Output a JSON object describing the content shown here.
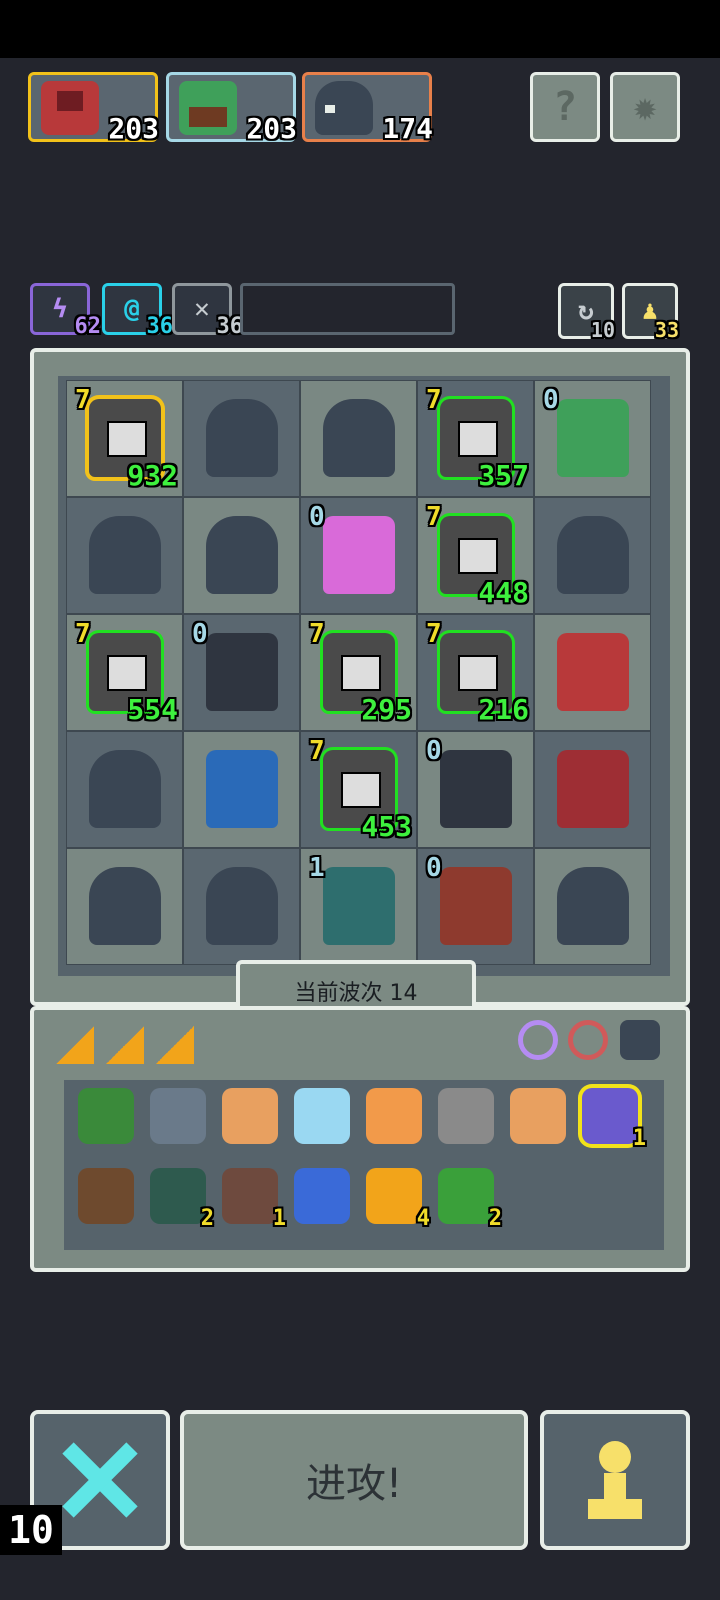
{
  "bosses": [
    {
      "name_icon": "red-demon-icon",
      "count": "203",
      "border": "#f2c21a"
    },
    {
      "name_icon": "frog-icon",
      "count": "203",
      "border": "#a6d8e6"
    },
    {
      "name_icon": "dark-beast-icon",
      "count": "174",
      "border": "#e8804a"
    }
  ],
  "top_buttons": {
    "help_icon": "question-icon",
    "settings_icon": "gear-icon"
  },
  "buffs": [
    {
      "icon": "lightning-icon",
      "value": "62",
      "color": "#b58cf2"
    },
    {
      "icon": "swirl-icon",
      "value": "36",
      "color": "#2ad0e8"
    },
    {
      "icon": "crossed-swords-icon",
      "value": "36",
      "color": "#c6ccd0"
    }
  ],
  "resources": [
    {
      "icon": "refresh-icon",
      "value": "10"
    },
    {
      "icon": "pawn-icon",
      "value": "33"
    }
  ],
  "board": {
    "rows": [
      [
        {
          "unit": "knight",
          "lvl": "7",
          "lvl_color": "y",
          "hp": "932",
          "glow": "gold"
        },
        {
          "unit": "beast"
        },
        {
          "unit": "beast"
        },
        {
          "unit": "knight",
          "lvl": "7",
          "lvl_color": "y",
          "hp": "357",
          "glow": "green"
        },
        {
          "unit": "frog",
          "lvl": "0",
          "lvl_color": "b"
        }
      ],
      [
        {
          "unit": "beast"
        },
        {
          "unit": "beast"
        },
        {
          "unit": "pink-demon",
          "lvl": "0",
          "lvl_color": "b"
        },
        {
          "unit": "knight",
          "lvl": "7",
          "lvl_color": "y",
          "hp": "448",
          "glow": "green"
        },
        {
          "unit": "beast"
        }
      ],
      [
        {
          "unit": "knight",
          "lvl": "7",
          "lvl_color": "y",
          "hp": "554",
          "glow": "green"
        },
        {
          "unit": "ghoul",
          "lvl": "0",
          "lvl_color": "b"
        },
        {
          "unit": "knight",
          "lvl": "7",
          "lvl_color": "y",
          "hp": "295",
          "glow": "green"
        },
        {
          "unit": "knight",
          "lvl": "7",
          "lvl_color": "y",
          "hp": "216",
          "glow": "green"
        },
        {
          "unit": "red-shaman"
        }
      ],
      [
        {
          "unit": "gargoyle"
        },
        {
          "unit": "blue-fish"
        },
        {
          "unit": "knight",
          "lvl": "7",
          "lvl_color": "y",
          "hp": "453",
          "glow": "green"
        },
        {
          "unit": "ghoul",
          "lvl": "0",
          "lvl_color": "b"
        },
        {
          "unit": "red-imp"
        }
      ],
      [
        {
          "unit": "beast"
        },
        {
          "unit": "beast"
        },
        {
          "unit": "teal-blob",
          "lvl": "1",
          "lvl_color": "b"
        },
        {
          "unit": "minotaur",
          "lvl": "0",
          "lvl_color": "b"
        },
        {
          "unit": "beast"
        }
      ]
    ]
  },
  "wave_label": "当前波次 14",
  "inventory": {
    "tabs": [
      "gold-triangle-icon",
      "gold-triangle-icon",
      "gold-triangle-icon"
    ],
    "slots": [
      "purple-ring-icon",
      "red-ring-icon",
      "armor-icon"
    ],
    "items_row1": [
      {
        "icon": "green-cross-shield-icon"
      },
      {
        "icon": "spiked-gear-icon"
      },
      {
        "icon": "claws-icon"
      },
      {
        "icon": "mask-icon"
      },
      {
        "icon": "orange-fruit-icon"
      },
      {
        "icon": "dagger-icon"
      },
      {
        "icon": "hammer-icon"
      },
      {
        "icon": "potion-jar-icon",
        "count": "1"
      }
    ],
    "items_row2": [
      {
        "icon": "spike-trap-icon"
      },
      {
        "icon": "shadow-cube-icon",
        "count": "2"
      },
      {
        "icon": "helmet-icon",
        "count": "1"
      },
      {
        "icon": "blue-flame-icon"
      },
      {
        "icon": "orbit-ring-icon",
        "count": "4"
      },
      {
        "icon": "green-hand-icon",
        "count": "2"
      }
    ]
  },
  "attack_label": "进攻!",
  "corner_number": "10",
  "colors": {
    "background": "#23252d",
    "panel": "#7c8a83",
    "panel_dark": "#56636b",
    "hp_green": "#3ef03e",
    "level_yellow": "#f0dc2a",
    "level_blue": "#a6d8e6"
  }
}
